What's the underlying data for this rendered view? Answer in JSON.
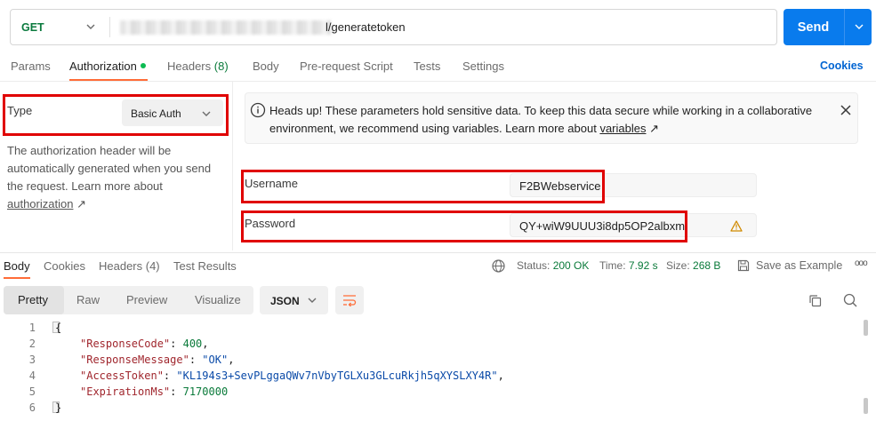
{
  "request": {
    "method": "GET",
    "url_suffix": "l/generatetoken",
    "send_label": "Send"
  },
  "request_tabs": [
    {
      "label": "Params"
    },
    {
      "label": "Authorization"
    },
    {
      "label": "Headers",
      "count": "(8)"
    },
    {
      "label": "Body"
    },
    {
      "label": "Pre-request Script"
    },
    {
      "label": "Tests"
    },
    {
      "label": "Settings"
    }
  ],
  "cookies_link": "Cookies",
  "auth": {
    "type_label": "Type",
    "type_value": "Basic Auth",
    "help_text": "The authorization header will be automatically generated when you send the request. Learn more about",
    "help_link": "authorization",
    "help_arrow": "↗"
  },
  "banner": {
    "text": "Heads up! These parameters hold sensitive data. To keep this data secure while working in a collaborative environment, we recommend using variables. Learn more about",
    "link": "variables",
    "arrow": "↗"
  },
  "fields": {
    "username_label": "Username",
    "username_value": "F2BWebservice",
    "password_label": "Password",
    "password_value": "QY+wiW9UUU3i8dp5OP2albxm"
  },
  "response_tabs": [
    {
      "label": "Body"
    },
    {
      "label": "Cookies"
    },
    {
      "label": "Headers (4)"
    },
    {
      "label": "Test Results"
    }
  ],
  "response_meta": {
    "status_label": "Status:",
    "status_value": "200 OK",
    "time_label": "Time:",
    "time_value": "7.92 s",
    "size_label": "Size:",
    "size_value": "268 B",
    "save_label": "Save as Example",
    "more": "ooo"
  },
  "format_tabs": [
    "Pretty",
    "Raw",
    "Preview",
    "Visualize"
  ],
  "format_select": "JSON",
  "code_lines": [
    {
      "n": "1",
      "text": "{"
    },
    {
      "n": "2",
      "key": "\"ResponseCode\"",
      "sep": ": ",
      "value": "400",
      "vtype": "num",
      "tail": ","
    },
    {
      "n": "3",
      "key": "\"ResponseMessage\"",
      "sep": ": ",
      "value": "\"OK\"",
      "vtype": "str",
      "tail": ","
    },
    {
      "n": "4",
      "key": "\"AccessToken\"",
      "sep": ": ",
      "value": "\"KL194s3+SevPLggaQWv7nVbyTGLXu3GLcuRkjh5qXYSLXY4R\"",
      "vtype": "str",
      "tail": ","
    },
    {
      "n": "5",
      "key": "\"ExpirationMs\"",
      "sep": ": ",
      "value": "7170000",
      "vtype": "num",
      "tail": ""
    },
    {
      "n": "6",
      "text": "}"
    }
  ],
  "colors": {
    "accent": "#ff6c37",
    "send": "#097bed",
    "highlight": "#e00000",
    "method": "#0b7a3e"
  }
}
